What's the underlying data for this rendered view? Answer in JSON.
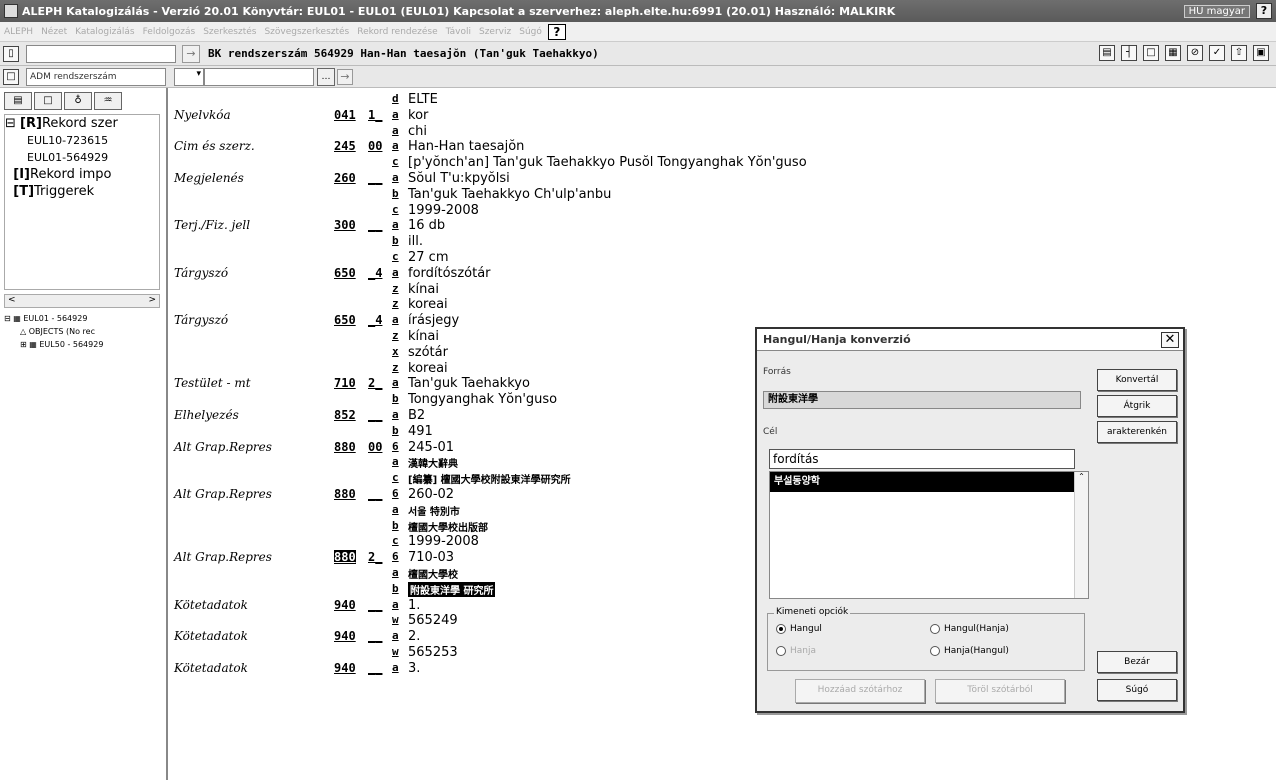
{
  "titlebar": {
    "title": "ALEPH Katalogizálás - Verzió 20.01 Könyvtár: EUL01 - EUL01 (EUL01) Kapcsolat a szerverhez: aleph.elte.hu:6991 (20.01) Használó: MALKIRK",
    "language": "HU magyar"
  },
  "menu": [
    "ALEPH",
    "Nézet",
    "Katalogizálás",
    "Feldolgozás",
    "Szerkesztés",
    "Szövegszerkesztés",
    "Rekord rendezése",
    "Távoli",
    "Szerviz",
    "Súgó"
  ],
  "toolbar": {
    "record_title": "BK rendszerszám 564929 Han-Han taesajŏn (Tan'guk Taehakkyo)"
  },
  "toolbar2": {
    "index_select": "ADM rendszerszám"
  },
  "left": {
    "tree": [
      {
        "prefix": "[R]",
        "label": "Rekord szer",
        "children": [
          "EUL10-723615",
          "EUL01-564929"
        ]
      },
      {
        "prefix": "[I]",
        "label": "Rekord impo",
        "children": []
      },
      {
        "prefix": "[T]",
        "label": "Triggerek",
        "children": []
      }
    ],
    "tree2": {
      "root": "EUL01 - 564929",
      "child1": "OBJECTS (No rec",
      "child2": "EUL50 - 564929"
    }
  },
  "record": [
    {
      "label": "",
      "tag": "",
      "ind": "",
      "sf": "d",
      "val": "ELTE"
    },
    {
      "label": "Nyelvkóa",
      "tag": "041",
      "ind": "1_",
      "sf": "a",
      "val": "kor"
    },
    {
      "label": "",
      "tag": "",
      "ind": "",
      "sf": "a",
      "val": "chi"
    },
    {
      "label": "Cim és szerz.",
      "tag": "245",
      "ind": "00",
      "sf": "a",
      "val": "Han-Han taesajŏn"
    },
    {
      "label": "",
      "tag": "",
      "ind": "",
      "sf": "c",
      "val": "[p'yŏnch'an] Tan'guk Taehakkyo Pusŏl Tongyanghak Yŏn'guso"
    },
    {
      "label": "Megjelenés",
      "tag": "260",
      "ind": "__",
      "sf": "a",
      "val": "Sŏul T'u:kpyŏlsi"
    },
    {
      "label": "",
      "tag": "",
      "ind": "",
      "sf": "b",
      "val": "Tan'guk Taehakkyo Ch'ulp'anbu"
    },
    {
      "label": "",
      "tag": "",
      "ind": "",
      "sf": "c",
      "val": "1999-2008"
    },
    {
      "label": "Terj./Fiz. jell",
      "tag": "300",
      "ind": "__",
      "sf": "a",
      "val": "16 db"
    },
    {
      "label": "",
      "tag": "",
      "ind": "",
      "sf": "b",
      "val": "ill."
    },
    {
      "label": "",
      "tag": "",
      "ind": "",
      "sf": "c",
      "val": "27 cm"
    },
    {
      "label": "Tárgyszó",
      "tag": "650",
      "ind": "_4",
      "sf": "a",
      "val": "fordítószótár"
    },
    {
      "label": "",
      "tag": "",
      "ind": "",
      "sf": "z",
      "val": "kínai"
    },
    {
      "label": "",
      "tag": "",
      "ind": "",
      "sf": "z",
      "val": "koreai"
    },
    {
      "label": "Tárgyszó",
      "tag": "650",
      "ind": "_4",
      "sf": "a",
      "val": "írásjegy"
    },
    {
      "label": "",
      "tag": "",
      "ind": "",
      "sf": "z",
      "val": "kínai"
    },
    {
      "label": "",
      "tag": "",
      "ind": "",
      "sf": "x",
      "val": "szótár"
    },
    {
      "label": "",
      "tag": "",
      "ind": "",
      "sf": "z",
      "val": "koreai"
    },
    {
      "label": "Testület - mt",
      "tag": "710",
      "ind": "2_",
      "sf": "a",
      "val": "Tan'guk Taehakkyo"
    },
    {
      "label": "",
      "tag": "",
      "ind": "",
      "sf": "b",
      "val": "Tongyanghak Yŏn'guso"
    },
    {
      "label": "Elhelyezés",
      "tag": "852",
      "ind": "__",
      "sf": "a",
      "val": "B2"
    },
    {
      "label": "",
      "tag": "",
      "ind": "",
      "sf": "b",
      "val": "491"
    },
    {
      "label": "Alt Grap.Repres",
      "tag": "880",
      "ind": "00",
      "sf": "6",
      "val": "245-01"
    },
    {
      "label": "",
      "tag": "",
      "ind": "",
      "sf": "a",
      "val": "漢韓大辭典",
      "cjk": true
    },
    {
      "label": "",
      "tag": "",
      "ind": "",
      "sf": "c",
      "val": "[編纂] 檀國大學校附設東洋學研究所",
      "cjk": true
    },
    {
      "label": "Alt Grap.Repres",
      "tag": "880",
      "ind": "__",
      "sf": "6",
      "val": "260-02"
    },
    {
      "label": "",
      "tag": "",
      "ind": "",
      "sf": "a",
      "val": "서울 特別市",
      "cjk": true
    },
    {
      "label": "",
      "tag": "",
      "ind": "",
      "sf": "b",
      "val": "檀國大學校出版部",
      "cjk": true
    },
    {
      "label": "",
      "tag": "",
      "ind": "",
      "sf": "c",
      "val": "1999-2008"
    },
    {
      "label": "Alt Grap.Repres",
      "tag": "880",
      "ind": "2_",
      "sf": "6",
      "val": "710-03",
      "taghl": true
    },
    {
      "label": "",
      "tag": "",
      "ind": "",
      "sf": "a",
      "val": "檀國大學校",
      "cjk": true
    },
    {
      "label": "",
      "tag": "",
      "ind": "",
      "sf": "b",
      "val": "附設東洋學 研究所",
      "hl": true
    },
    {
      "label": "Kötetadatok",
      "tag": "940",
      "ind": "__",
      "sf": "a",
      "val": "1."
    },
    {
      "label": "",
      "tag": "",
      "ind": "",
      "sf": "w",
      "val": "565249"
    },
    {
      "label": "Kötetadatok",
      "tag": "940",
      "ind": "__",
      "sf": "a",
      "val": "2."
    },
    {
      "label": "",
      "tag": "",
      "ind": "",
      "sf": "w",
      "val": "565253"
    },
    {
      "label": "Kötetadatok",
      "tag": "940",
      "ind": "__",
      "sf": "a",
      "val": "3."
    }
  ],
  "dialog": {
    "title": "Hangul/Hanja konverzió",
    "source_label": "Forrás",
    "source_value": "附設東洋學",
    "target_label": "Cél",
    "target_input": "fordítás",
    "list_selected": "부설동양학",
    "btn_convert": "Konvertál",
    "btn_transfer": "Átgrik",
    "btn_char": "arakterenkén",
    "options_legend": "Kimeneti opciók",
    "opt_hangul": "Hangul",
    "opt_hangul_hanja": "Hangul(Hanja)",
    "opt_hanja": "Hanja",
    "opt_hanja_hangul": "Hanja(Hangul)",
    "btn_add_dict": "Hozzáad szótárhoz",
    "btn_del_dict": "Töröl szótárból",
    "btn_close": "Bezár",
    "btn_help": "Súgó"
  }
}
